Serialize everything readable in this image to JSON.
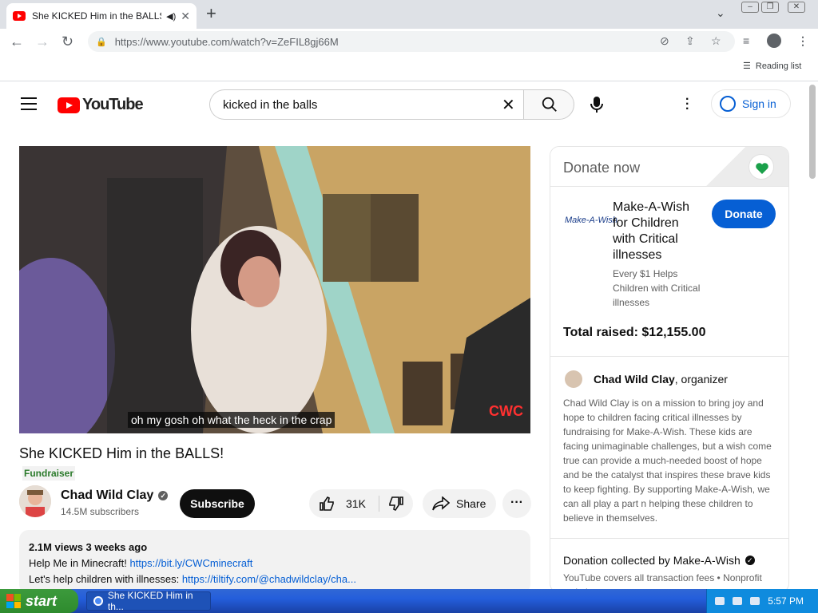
{
  "browser": {
    "tab_title": "She KICKED Him in the BALLS!",
    "url": "https://www.youtube.com/watch?v=ZeFIL8gj66M",
    "reading_list": "Reading list"
  },
  "youtube": {
    "logo_text": "YouTube",
    "search_value": "kicked in the balls",
    "sign_in": "Sign in"
  },
  "video": {
    "caption": "oh my gosh oh what the heck in the crap",
    "title": "She KICKED Him in the BALLS!",
    "badge": "Fundraiser",
    "channel_name": "Chad Wild Clay",
    "subscribers": "14.5M subscribers",
    "subscribe_label": "Subscribe",
    "likes": "31K",
    "share_label": "Share",
    "views_date": "2.1M views  3 weeks ago",
    "desc_line1_text": "Help Me in Minecraft! ",
    "desc_line1_link": "https://bit.ly/CWCminecraft",
    "desc_line2_text": "Let's help children with illnesses: ",
    "desc_line2_link": "https://tiltify.com/@chadwildclay/cha..."
  },
  "donate": {
    "header": "Donate now",
    "logo_text": "Make-A-Wish",
    "charity_name": "Make-A-Wish for Children with Critical illnesses",
    "charity_sub": "Every $1 Helps Children with Critical illnesses",
    "donate_label": "Donate",
    "raised": "Total raised: $12,155.00",
    "organizer_name": "Chad Wild Clay",
    "organizer_role": ", organizer",
    "organizer_text": "Chad Wild Clay is on a mission to bring joy and hope to children facing critical illnesses by fundraising for Make-A-Wish. These kids are facing unimaginable challenges, but a wish come true can provide a much-needed boost of hope and be the catalyst that inspires these brave kids to keep fighting. By supporting Make-A-Wish, we can all play a part n helping these children to believe in themselves.",
    "collected": "Donation collected by Make-A-Wish",
    "fees": "YouTube covers all transaction fees  •  Nonprofit website"
  },
  "taskbar": {
    "start": "start",
    "task_item": "She KICKED Him in th...",
    "clock": "5:57 PM"
  },
  "colors": {
    "youtube_red": "#ff0000",
    "link_blue": "#065fd4",
    "xp_taskbar": "#245edb",
    "xp_start": "#3c9a3c"
  }
}
